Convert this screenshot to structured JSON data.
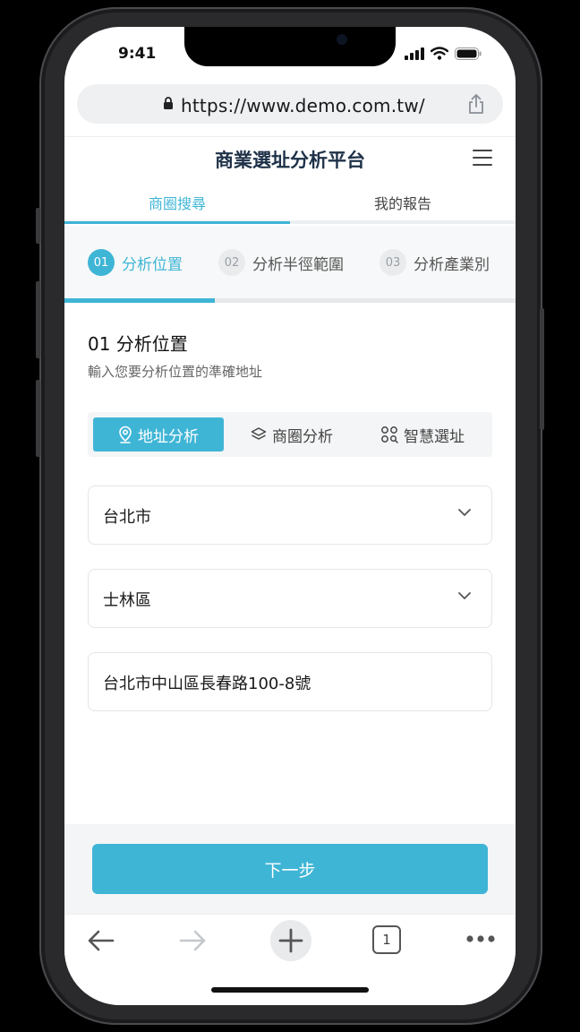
{
  "status": {
    "time": "9:41"
  },
  "browser": {
    "url": "https://www.demo.com.tw/"
  },
  "header": {
    "title": "商業選址分析平台"
  },
  "tabs": [
    {
      "label": "商圈搜尋",
      "active": true
    },
    {
      "label": "我的報告",
      "active": false
    }
  ],
  "steps": [
    {
      "num": "01",
      "label": "分析位置",
      "active": true
    },
    {
      "num": "02",
      "label": "分析半徑範圍",
      "active": false
    },
    {
      "num": "03",
      "label": "分析產業別",
      "active": false
    }
  ],
  "steps_progress": 0.333,
  "section": {
    "title": "01 分析位置",
    "subtitle": "輸入您要分析位置的準確地址"
  },
  "modes": [
    {
      "label": "地址分析",
      "icon": "map-pin-icon",
      "active": true
    },
    {
      "label": "商圈分析",
      "icon": "layers-icon",
      "active": false
    },
    {
      "label": "智慧選址",
      "icon": "apps-search-icon",
      "active": false
    }
  ],
  "form": {
    "city": "台北市",
    "district": "士林區",
    "address": "台北市中山區長春路100-8號"
  },
  "actions": {
    "next_label": "下一步"
  },
  "browser_toolbar": {
    "tab_count": "1"
  },
  "colors": {
    "accent": "#3fb5d6",
    "title": "#1e3148"
  }
}
